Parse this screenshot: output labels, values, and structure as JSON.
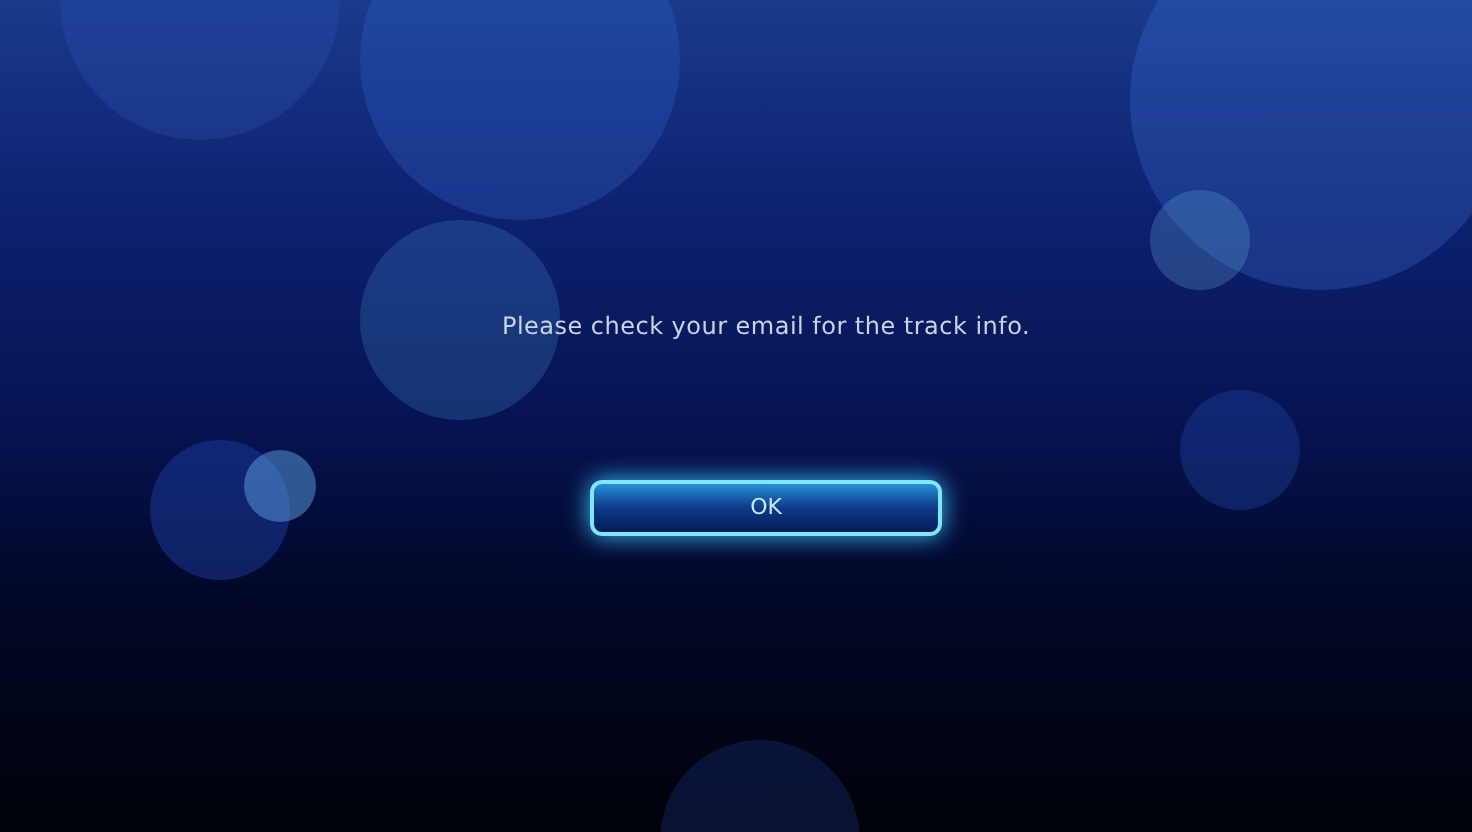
{
  "dialog": {
    "message": "Please check your email for the track info.",
    "button": {
      "label": "OK",
      "focused": true
    }
  }
}
